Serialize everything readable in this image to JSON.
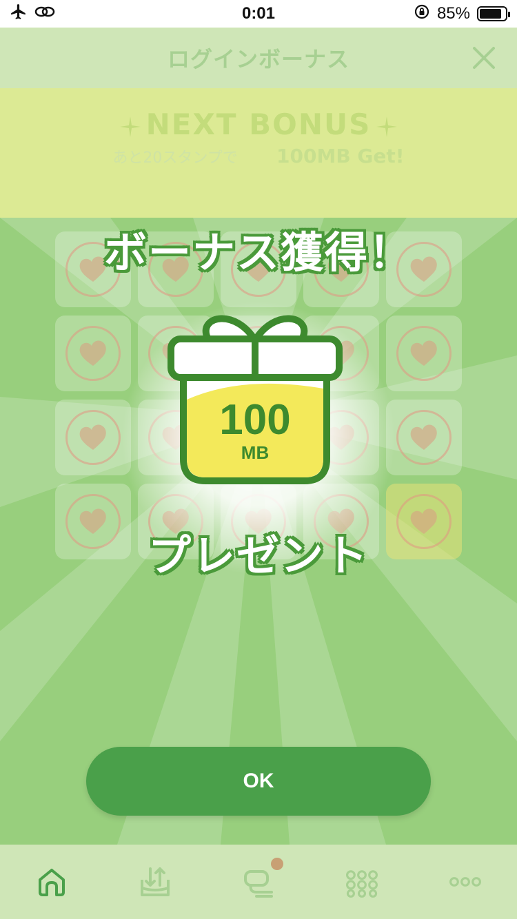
{
  "status_bar": {
    "time": "0:01",
    "battery_percent": "85%",
    "battery_level": 0.85,
    "icons": [
      "airplane-icon",
      "link-icon",
      "rotation-lock-icon",
      "battery-icon"
    ]
  },
  "header": {
    "title": "ログインボーナス",
    "close_icon": "close-icon"
  },
  "next_bonus": {
    "title": "NEXT BONUS",
    "remaining": "あと20スタンプで",
    "reward": "100MB Get!"
  },
  "bonus_popup": {
    "title": "ボーナス獲得！",
    "gift_amount": "100",
    "gift_unit": "MB",
    "present_label": "プレゼント",
    "ok_label": "OK"
  },
  "stamps": {
    "rows": 4,
    "cols": 5,
    "highlighted_index": 19
  },
  "tab_bar": {
    "tabs": [
      {
        "name": "home-icon"
      },
      {
        "name": "download-tray-icon"
      },
      {
        "name": "chat-icon",
        "badge": true
      },
      {
        "name": "grid-dots-icon"
      },
      {
        "name": "more-icon"
      }
    ]
  },
  "colors": {
    "accent_green": "#4aa04a",
    "dark_green": "#3d8a2e",
    "yellow": "#f3e95a",
    "header_bg": "#cfe6b7"
  }
}
